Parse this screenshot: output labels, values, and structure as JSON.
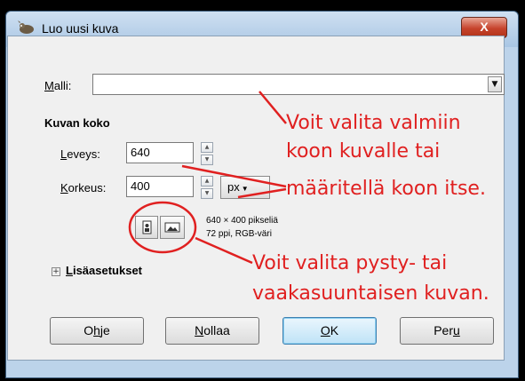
{
  "window": {
    "title": "Luo uusi kuva",
    "close_glyph": "X"
  },
  "template": {
    "label_first": "M",
    "label_rest": "alli:",
    "value": ""
  },
  "image_size": {
    "heading": "Kuvan koko",
    "width_label_first": "L",
    "width_label_rest": "eveys:",
    "width_value": "640",
    "height_label_first": "K",
    "height_label_rest": "orkeus:",
    "height_value": "400",
    "unit": "px",
    "info_line1": "640 × 400 pikseliä",
    "info_line2": "72 ppi, RGB-väri"
  },
  "advanced": {
    "label_first": "L",
    "label_rest": "isäasetukset",
    "expander_glyph": "+"
  },
  "buttons": {
    "help": {
      "pre": "O",
      "mn": "h",
      "post": "je"
    },
    "reset": {
      "pre": "",
      "mn": "N",
      "post": "ollaa"
    },
    "ok": {
      "pre": "",
      "mn": "O",
      "post": "K"
    },
    "cancel": {
      "pre": "Per",
      "mn": "u",
      "post": ""
    }
  },
  "annotations": {
    "top_line1": "Voit valita valmiin",
    "top_line2": "koon kuvalle tai",
    "top_line3": "määritellä koon itse.",
    "bottom_line1": "Voit valita pysty- tai",
    "bottom_line2": "vaakasuuntaisen kuvan."
  },
  "colors": {
    "annotation": "#e02020",
    "title_bar": "#bcd3ea",
    "close": "#c6432c"
  },
  "icons": [
    "wilber-app-icon",
    "chevron-down-icon",
    "spin-up-icon",
    "spin-down-icon",
    "portrait-icon",
    "landscape-icon",
    "plus-icon"
  ]
}
